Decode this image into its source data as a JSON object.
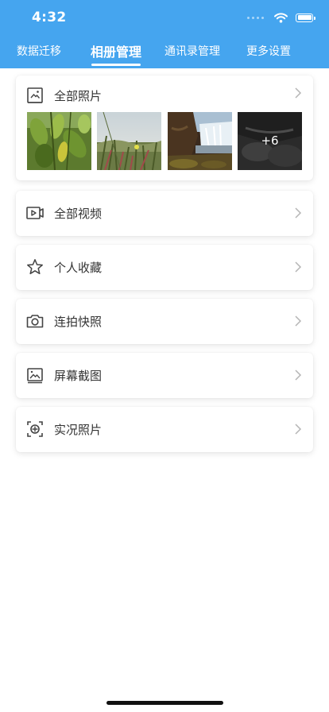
{
  "status_bar": {
    "time": "4:32"
  },
  "tabs": [
    {
      "label": "数据迁移"
    },
    {
      "label": "相册管理"
    },
    {
      "label": "通讯录管理"
    },
    {
      "label": "更多设置"
    }
  ],
  "active_tab": "相册管理",
  "all_photos": {
    "label": "全部照片",
    "more_count": "+6"
  },
  "menu": [
    {
      "label": "全部视频",
      "icon": "video-icon"
    },
    {
      "label": "个人收藏",
      "icon": "star-icon"
    },
    {
      "label": "连拍快照",
      "icon": "camera-icon"
    },
    {
      "label": "屏幕截图",
      "icon": "screenshot-icon"
    },
    {
      "label": "实况照片",
      "icon": "live-photo-icon"
    }
  ],
  "colors": {
    "header": "#45a5ef",
    "text": "#333333",
    "chevron": "#b5b5b5"
  }
}
